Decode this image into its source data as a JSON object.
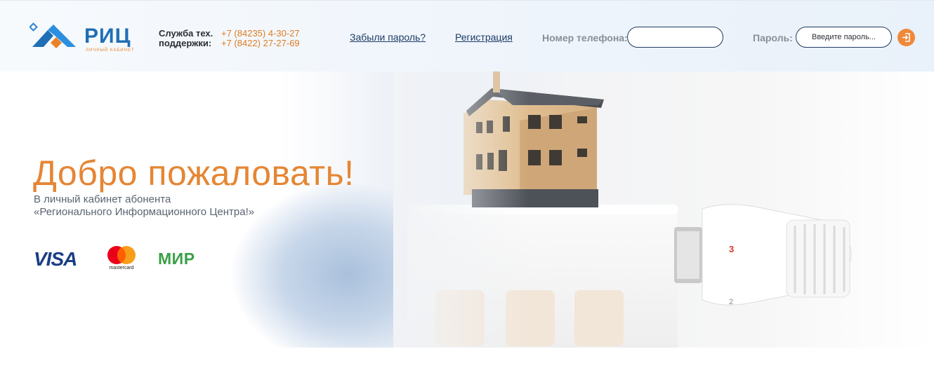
{
  "header": {
    "logo": {
      "name": "РИЦ",
      "tagline": "ЛИЧНЫЙ КАБИНЕТ",
      "icon": "house-roof-logo-icon"
    },
    "support": {
      "label_line1": "Служба тех.",
      "label_line2": "поддержки:",
      "phone1": "+7 (84235) 4-30-27",
      "phone2": "+7 (8422) 27-27-69"
    },
    "links": {
      "forgot_password": "Забыли пароль?",
      "register": "Регистрация"
    },
    "login": {
      "phone_label": "Номер телефона:",
      "phone_value": "",
      "password_label": "Пароль:",
      "password_placeholder": "Введите пароль...",
      "submit_icon": "login-arrow-icon"
    }
  },
  "hero": {
    "title": "Добро пожаловать!",
    "subtitle_line1": "В личный кабинет абонента",
    "subtitle_line2": "«Регионального Информационного Центра!»",
    "payments": {
      "visa": "VISA",
      "mastercard": "mastercard",
      "mir": "МИР"
    }
  },
  "colors": {
    "accent_orange": "#e58634",
    "brand_blue": "#1f6fb6",
    "dark_navy": "#1f3a5f",
    "mir_green": "#3aa047"
  }
}
